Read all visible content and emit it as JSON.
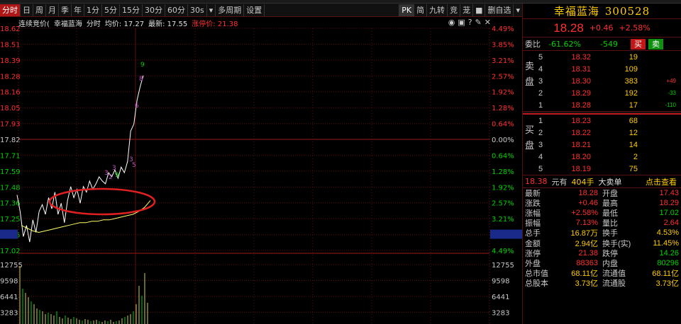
{
  "toolbar": {
    "period_buttons": [
      "分时",
      "日",
      "周",
      "月",
      "季",
      "年",
      "1分",
      "5分",
      "15分",
      "30分",
      "60分",
      "30s",
      "多周期",
      "设置"
    ],
    "right_buttons": [
      "PK",
      "简",
      "九转",
      "竞",
      "茏",
      "■",
      "删自选",
      "▾"
    ]
  },
  "chart": {
    "info": {
      "label": "连续竞价(",
      "name": "幸福蓝海",
      "mode": "分时",
      "avg": "均价: 17.27",
      "last": "最新: 17.55",
      "limit": "涨停价: 21.38"
    },
    "icons": [
      "eye-icon",
      "camera-icon",
      "help-icon",
      "edit-icon",
      "close-icon"
    ],
    "left_axis": [
      "18.62",
      "18.51",
      "18.39",
      "18.28",
      "18.16",
      "18.05",
      "17.93",
      "17.82",
      "17.71",
      "17.59",
      "17.48",
      "17.36",
      "17.25",
      "17.15",
      "17.02"
    ],
    "right_axis": [
      "4.49%",
      "3.85%",
      "3.21%",
      "2.57%",
      "1.92%",
      "1.28%",
      "0.64%",
      "0.00%",
      "0.64%",
      "1.28%",
      "1.92%",
      "2.57%",
      "3.21%",
      "3.75%",
      "4.49%"
    ],
    "vol_axis_left": [
      "12755",
      "9598",
      "6441",
      "3283"
    ],
    "vol_axis_right": [
      "12755",
      "9598",
      "6441",
      "3283"
    ],
    "markers": [
      "9",
      "8",
      "6",
      "3",
      "2",
      "3",
      "9",
      "3",
      "5"
    ],
    "colors": {
      "price_line": "#ffffff",
      "avg_line": "#ffff66",
      "up_grid": "#7a1414",
      "circle": "#e02020"
    }
  },
  "panel": {
    "name": "幸福蓝海",
    "code": "300528",
    "price": "18.28",
    "change": "+0.46",
    "change_pct": "+2.58%",
    "weibi_label": "委比",
    "weibi_pct": "-61.62%",
    "weibi_diff": "-549",
    "buy_btn": "买",
    "sell_btn": "卖",
    "sell_side_label": [
      "卖",
      "盘"
    ],
    "buy_side_label": [
      "买",
      "盘"
    ],
    "asks": [
      {
        "lv": "5",
        "px": "18.32",
        "vol": "19",
        "chg": ""
      },
      {
        "lv": "4",
        "px": "18.31",
        "vol": "109",
        "chg": ""
      },
      {
        "lv": "3",
        "px": "18.30",
        "vol": "383",
        "chg": "+49"
      },
      {
        "lv": "2",
        "px": "18.29",
        "vol": "192",
        "chg": "-33"
      },
      {
        "lv": "1",
        "px": "18.28",
        "vol": "17",
        "chg": "-110"
      }
    ],
    "bids": [
      {
        "lv": "1",
        "px": "18.23",
        "vol": "68"
      },
      {
        "lv": "2",
        "px": "18.22",
        "vol": "12"
      },
      {
        "lv": "3",
        "px": "18.21",
        "vol": "14"
      },
      {
        "lv": "4",
        "px": "18.20",
        "vol": "2"
      },
      {
        "lv": "5",
        "px": "18.19",
        "vol": "75"
      }
    ],
    "trade_bar": {
      "price": "18.38",
      "unit": "元有",
      "vol": "404手",
      "label": "大卖单",
      "link": "点击查看"
    },
    "stats": [
      {
        "k": "最新",
        "v": "18.28",
        "vc": "red",
        "k2": "开盘",
        "v2": "17.43",
        "v2c": "red"
      },
      {
        "k": "涨跌",
        "v": "+0.46",
        "vc": "red",
        "k2": "最高",
        "v2": "18.29",
        "v2c": "red"
      },
      {
        "k": "涨幅",
        "v": "+2.58%",
        "vc": "red",
        "k2": "最低",
        "v2": "17.02",
        "v2c": "grn"
      },
      {
        "k": "振幅",
        "v": "7.13%",
        "vc": "red",
        "k2": "量比",
        "v2": "2.64",
        "v2c": "red"
      },
      {
        "k": "总手",
        "v": "16.87万",
        "vc": "yel",
        "k2": "换手",
        "v2": "4.53%",
        "v2c": "yel"
      },
      {
        "k": "金额",
        "v": "2.94亿",
        "vc": "yel",
        "k2": "换手(实)",
        "v2": "11.45%",
        "v2c": "yel"
      },
      {
        "k": "涨停",
        "v": "21.38",
        "vc": "red",
        "k2": "跌停",
        "v2": "14.26",
        "v2c": "grn"
      },
      {
        "k": "外盘",
        "v": "88363",
        "vc": "red",
        "k2": "内盘",
        "v2": "80296",
        "v2c": "grn"
      },
      {
        "k": "总市值",
        "v": "68.11亿",
        "vc": "yel",
        "k2": "流通值",
        "v2": "68.11亿",
        "v2c": "yel"
      },
      {
        "k": "总股本",
        "v": "3.73亿",
        "vc": "yel",
        "k2": "流通股",
        "v2": "3.73亿",
        "v2c": "yel"
      }
    ]
  }
}
